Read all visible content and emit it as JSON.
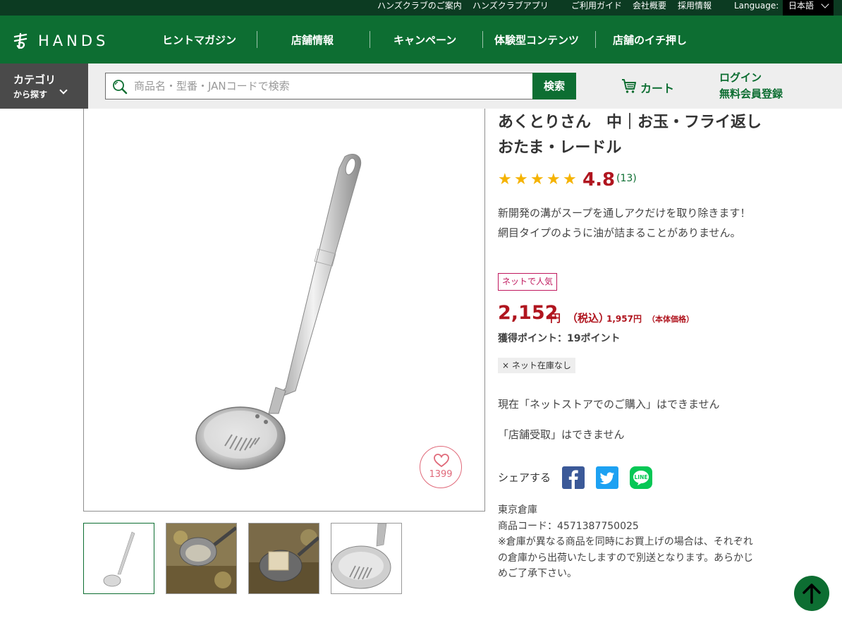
{
  "topbar": {
    "links": [
      "ハンズクラブのご案内",
      "ハンズクラブアプリ",
      "ご利用ガイド",
      "会社概要",
      "採用情報"
    ],
    "language_label": "Language:",
    "language_value": "日本語"
  },
  "header": {
    "logo_text": "HANDS",
    "nav": [
      "ヒントマガジン",
      "店舗情報",
      "キャンペーン",
      "体験型コンテンツ",
      "店舗のイチ押し"
    ]
  },
  "search": {
    "category_line1": "カテゴリ",
    "category_line2": "から探す",
    "placeholder": "商品名・型番・JANコードで検索",
    "button": "検索",
    "cart": "カート",
    "login": "ログイン",
    "register": "無料会員登録"
  },
  "product": {
    "title": "あくとりさん　中｜お玉・フライ返し　おたま・レードル",
    "rating": "4.8",
    "review_count": "(13)",
    "stars": 5,
    "description": "新開発の溝がスープを通しアクだけを取り除きます！網目タイプのように油が詰まることがありません。",
    "badge": "ネットで人気",
    "price": "2,152",
    "price_yen": "円",
    "price_tax": "（税込）",
    "price_base": "1,957円",
    "price_base_note": "（本体価格）",
    "points": "獲得ポイント：19ポイント",
    "stock": "× ネット在庫なし",
    "notice_online": "現在「ネットストアでのご購入」はできません",
    "notice_store": "「店舗受取」はできません",
    "share_label": "シェアする",
    "warehouse": "東京倉庫",
    "product_code": "商品コード：4571387750025",
    "shipping_note": "※倉庫が異なる商品を同時にお買上げの場合は、それぞれの倉庫から出荷いたしますので別送となります。あらかじめご了承下さい。",
    "favorites": "1399",
    "share_line_label": "LINE"
  },
  "colors": {
    "brand_green": "#0d6e32",
    "topbar_dark": "#0c3b22",
    "price_red": "#b0151f",
    "badge_pink": "#c0185e",
    "star_gold": "#f5b301"
  }
}
